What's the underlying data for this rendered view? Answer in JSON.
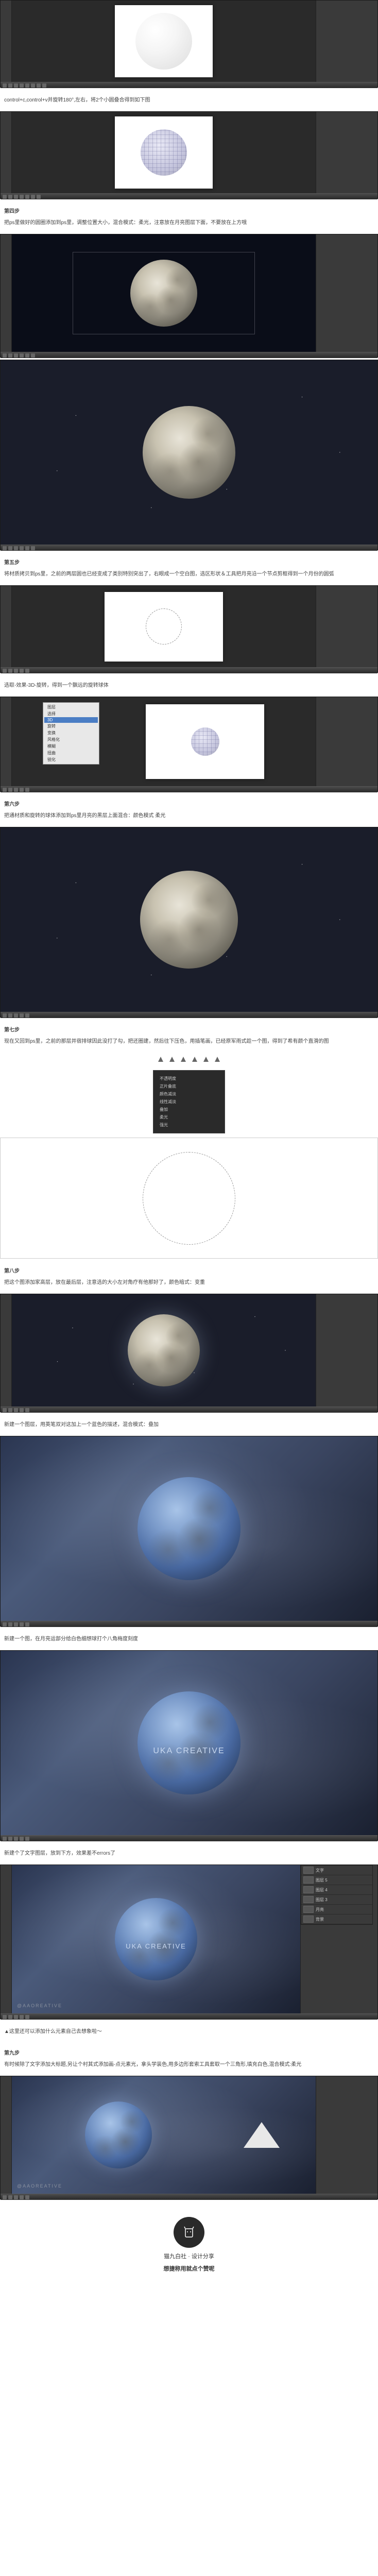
{
  "steps": {
    "s2_note": "control+c,control+v并旋转180°,左右，将2个小圆叠合得到如下图",
    "s4_title": "第四步",
    "s4_text": "把ps里做好的圆圈添加到ps里，调整位置大小，混合模式：柔光，注意放在月亮图层下面，不要放在上方哦",
    "s5_title": "第五步",
    "s5_text": "将材质拷贝到ps里，之前的两层圆也已经变成了类别特别突出了，右眼成一个空白图，选区形状＆工具把月亮沿一个节点剪框得到一个月份的圆弧",
    "s5b_text": "选取-效果-3D-旋转，得到一个飘远的旋转球体",
    "s6_title": "第六步",
    "s6_text": "把通材质和旋转的球体添加到ps里月亮的黑层上面混合：颜色模式 柔光",
    "s7_title": "第七步",
    "s7_text": "现在又回到ps里，之前的那层并宿排球因此没打了勾，把还圈建，然后往下压色，用插笔画，已经原军雨式趁一个图，得到了希有颜个直滑的图",
    "s8_title": "第八步",
    "s8_text": "把这个图添加家高层，放在最后层，注意选的大小左对角疗有他那好了，颜色暗式：变重",
    "s8b_text": "新建一个图层，用英笔双对这加上一个蓝色的描述，混合模式：叠加",
    "s8c_text": "新建一个图，在月亮运部分给白色细想球打个八角梅度刻度",
    "s8d_text": "新建个了文字图层，放到下方，效果差不errors了",
    "s8e_note": "▲这里还可以添加什么元素自己去想象啦～",
    "s9_title": "第九步",
    "s9_text": "有时候除了文字添加大标题,另让个村其式添加画-点元素光，拿头学装色,用多边形套索工具套取一个三角形,填充白色,混合模式:柔光",
    "brand": "UKA CREATIVE",
    "watermark_text": "@AAOREATIVE"
  },
  "footer": {
    "line1": "猫九白社 · 设计分享",
    "line2": "想捷称用就点个赞呢"
  }
}
